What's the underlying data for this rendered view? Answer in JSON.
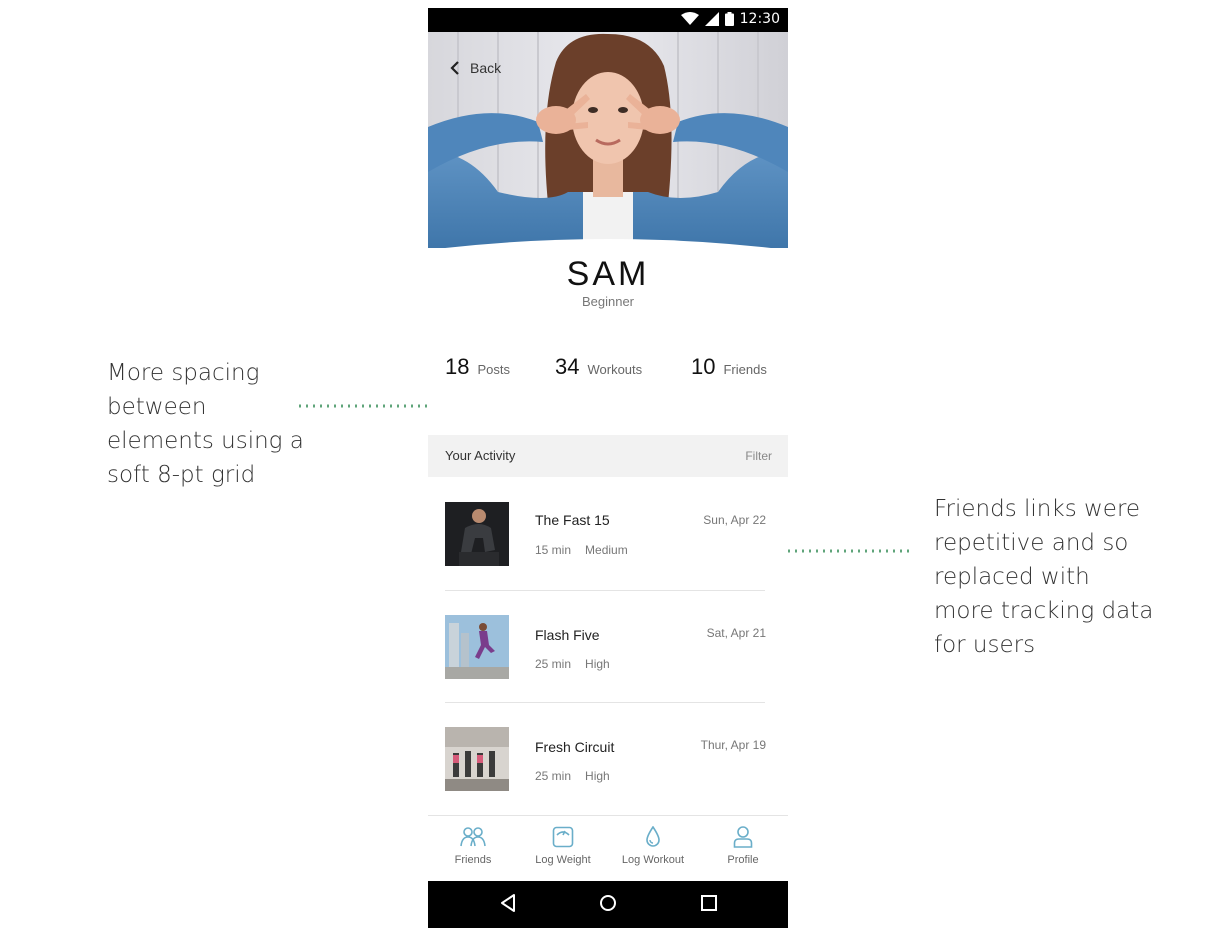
{
  "status_bar": {
    "time": "12:30"
  },
  "hero": {
    "back_label": "Back"
  },
  "profile": {
    "name": "SAM",
    "level": "Beginner"
  },
  "stats": [
    {
      "value": "18",
      "label": "Posts"
    },
    {
      "value": "34",
      "label": "Workouts"
    },
    {
      "value": "10",
      "label": "Friends"
    }
  ],
  "activity": {
    "title": "Your Activity",
    "filter_label": "Filter",
    "items": [
      {
        "title": "The Fast 15",
        "duration": "15 min",
        "intensity": "Medium",
        "date": "Sun, Apr 22"
      },
      {
        "title": "Flash Five",
        "duration": "25 min",
        "intensity": "High",
        "date": "Sat, Apr 21"
      },
      {
        "title": "Fresh Circuit",
        "duration": "25 min",
        "intensity": "High",
        "date": "Thur, Apr 19"
      }
    ]
  },
  "bottom_nav": [
    {
      "label": "Friends",
      "icon": "friends-icon"
    },
    {
      "label": "Log Weight",
      "icon": "scale-icon"
    },
    {
      "label": "Log Workout",
      "icon": "water-drop-icon"
    },
    {
      "label": "Profile",
      "icon": "profile-icon"
    }
  ],
  "annotations": {
    "left": "More spacing between elements using a soft 8-pt grid",
    "right": "Friends links were repetitive and so replaced with more tracking data for users"
  },
  "colors": {
    "accent": "#5fa47a",
    "nav_icon": "#6aaec9",
    "header_bg": "#f2f2f2",
    "system_bar": "#000000"
  }
}
